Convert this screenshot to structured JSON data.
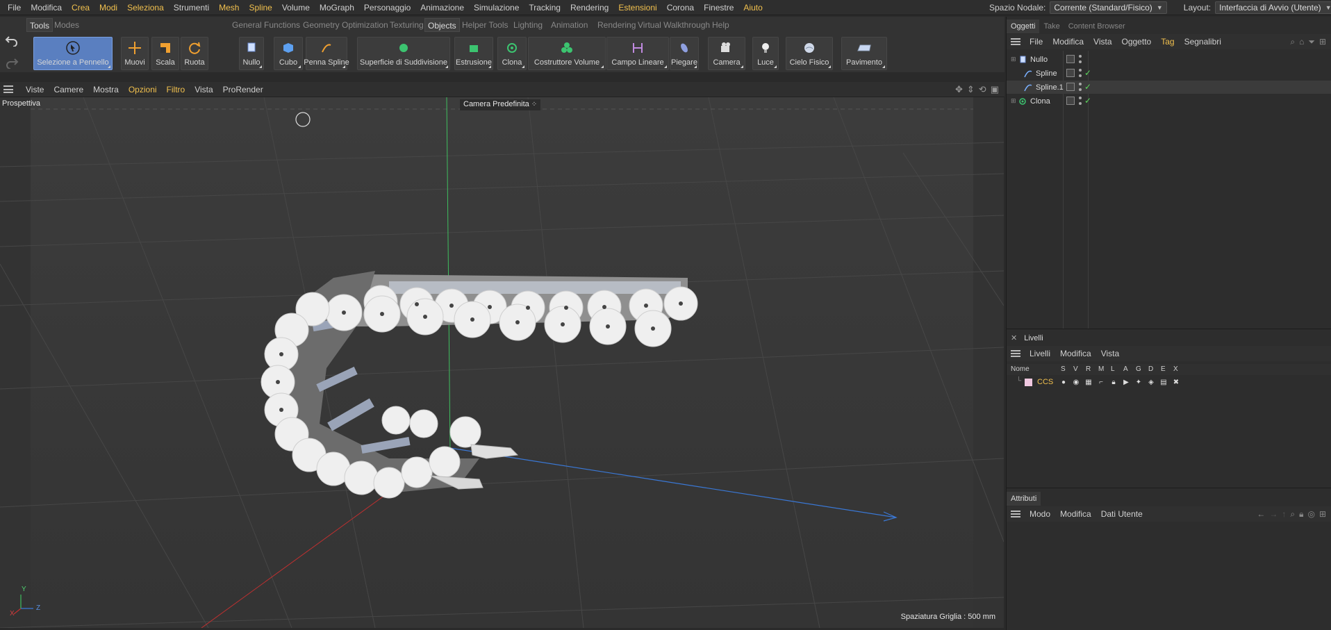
{
  "menubar": {
    "items": [
      "File",
      "Modifica",
      "Crea",
      "Modi",
      "Seleziona",
      "Strumenti",
      "Mesh",
      "Spline",
      "Volume",
      "MoGraph",
      "Personaggio",
      "Animazione",
      "Simulazione",
      "Tracking",
      "Rendering",
      "Estensioni",
      "Corona",
      "Finestre",
      "Aiuto"
    ],
    "highlighted": [
      "Crea",
      "Modi",
      "Seleziona",
      "Mesh",
      "Spline",
      "Estensioni",
      "Aiuto"
    ],
    "node_space_label": "Spazio Nodale:",
    "node_space_value": "Corrente (Standard/Fisico)",
    "layout_label": "Layout:",
    "layout_value": "Interfaccia di Avvio (Utente)"
  },
  "palettes": {
    "left_tabs": [
      "Tools",
      "Modes"
    ],
    "right_tabs": [
      "General Functions",
      "Geometry Optimization",
      "Texturing",
      "Objects",
      "Helper Tools",
      "Lighting",
      "Animation",
      "Rendering",
      "Virtual Walkthrough",
      "Help"
    ],
    "active_right_tab": "Objects"
  },
  "toolbar": {
    "selection": "Selezione a Pennello",
    "move": "Muovi",
    "scale": "Scala",
    "rotate": "Ruota",
    "objects": [
      "Nullo",
      "Cubo",
      "Penna Spline",
      "Superficie di Suddivisione",
      "Estrusione",
      "Clona",
      "Costruttore Volume",
      "Campo Lineare",
      "Piegare",
      "Camera",
      "Luce",
      "Cielo Fisico",
      "Pavimento"
    ]
  },
  "viewport": {
    "menu": [
      "Viste",
      "Camere",
      "Mostra",
      "Opzioni",
      "Filtro",
      "Vista",
      "ProRender"
    ],
    "menu_highlighted": [
      "Opzioni",
      "Filtro"
    ],
    "view_name": "Prospettiva",
    "camera": "Camera Predefinita",
    "grid_spacing": "Spaziatura Griglia : 500 mm",
    "axis_y": "Y",
    "axis_z": "Z",
    "axis_x": "X"
  },
  "objects_panel": {
    "tabs": [
      "Oggetti",
      "Take",
      "Content Browser"
    ],
    "menu": [
      "File",
      "Modifica",
      "Vista",
      "Oggetto",
      "Tag",
      "Segnalibri"
    ],
    "menu_highlighted": [
      "Tag"
    ],
    "rows": [
      {
        "name": "Nullo",
        "icon": "null-object-icon",
        "checked": false
      },
      {
        "name": "Spline",
        "icon": "spline-icon",
        "checked": true
      },
      {
        "name": "Spline.1",
        "icon": "spline-icon",
        "checked": true
      },
      {
        "name": "Clona",
        "icon": "cloner-icon",
        "checked": true
      }
    ]
  },
  "layers_panel": {
    "title": "Livelli",
    "menu": [
      "Livelli",
      "Modifica",
      "Vista"
    ],
    "col_name": "Nome",
    "cols": [
      "S",
      "V",
      "R",
      "M",
      "L",
      "A",
      "G",
      "D",
      "E",
      "X"
    ],
    "layer_name": "CCS",
    "layer_color": "#f0c8e0"
  },
  "attributes_panel": {
    "title": "Attributi",
    "menu": [
      "Modo",
      "Modifica",
      "Dati Utente"
    ]
  },
  "colors": {
    "accent": "#f2c14e",
    "active_tool": "#5a7fc0",
    "check": "#5cd65c",
    "axis_x": "#c03030",
    "axis_y": "#30c060",
    "axis_z": "#3070d0"
  }
}
